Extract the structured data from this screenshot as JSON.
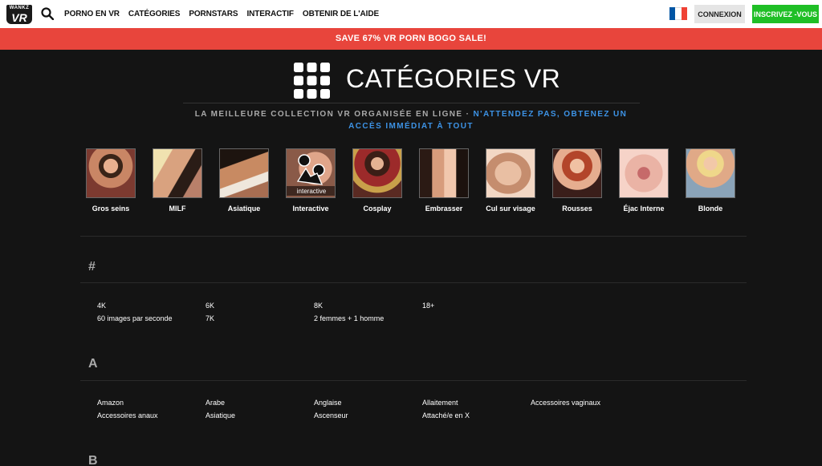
{
  "topbar": {
    "logo_top": "WANKZ",
    "logo_main": "VR",
    "nav": [
      "PORNO EN VR",
      "CATÉGORIES",
      "PORNSTARS",
      "INTERACTIF",
      "OBTENIR DE L'AIDE"
    ],
    "login_label": "CONNEXION",
    "signup_label": "INSCRIVEZ -VOUS",
    "colors": {
      "signup": "#1fbf26",
      "promo": "#e8453c"
    }
  },
  "promo": {
    "text": "SAVE 67% VR PORN BOGO SALE!"
  },
  "header": {
    "title": "CATÉGORIES VR",
    "tagline_muted": "LA MEILLEURE COLLECTION VR ORGANISÉE EN LIGNE · ",
    "tagline_accent": "N'ATTENDEZ PAS, OBTENEZ UN ACCÈS IMMÉDIAT À TOUT",
    "accent_color": "#3d93e6"
  },
  "featured": [
    {
      "label": "Gros seins"
    },
    {
      "label": "MILF"
    },
    {
      "label": "Asiatique"
    },
    {
      "label": "Interactive",
      "overlay": "interactive"
    },
    {
      "label": "Cosplay"
    },
    {
      "label": "Embrasser"
    },
    {
      "label": "Cul sur visage"
    },
    {
      "label": "Rousses"
    },
    {
      "label": "Éjac Interne"
    },
    {
      "label": "Blonde"
    }
  ],
  "sections": [
    {
      "letter": "#",
      "items": [
        "4K",
        "6K",
        "8K",
        "18+",
        "60 images par seconde",
        "7K",
        "2 femmes + 1 homme"
      ]
    },
    {
      "letter": "A",
      "items": [
        "Amazon",
        "Arabe",
        "Anglaise",
        "Allaitement",
        "Accessoires vaginaux",
        "Accessoires anaux",
        "Asiatique",
        "Ascenseur",
        "Attaché/e en X"
      ]
    },
    {
      "letter": "B",
      "items": []
    }
  ]
}
